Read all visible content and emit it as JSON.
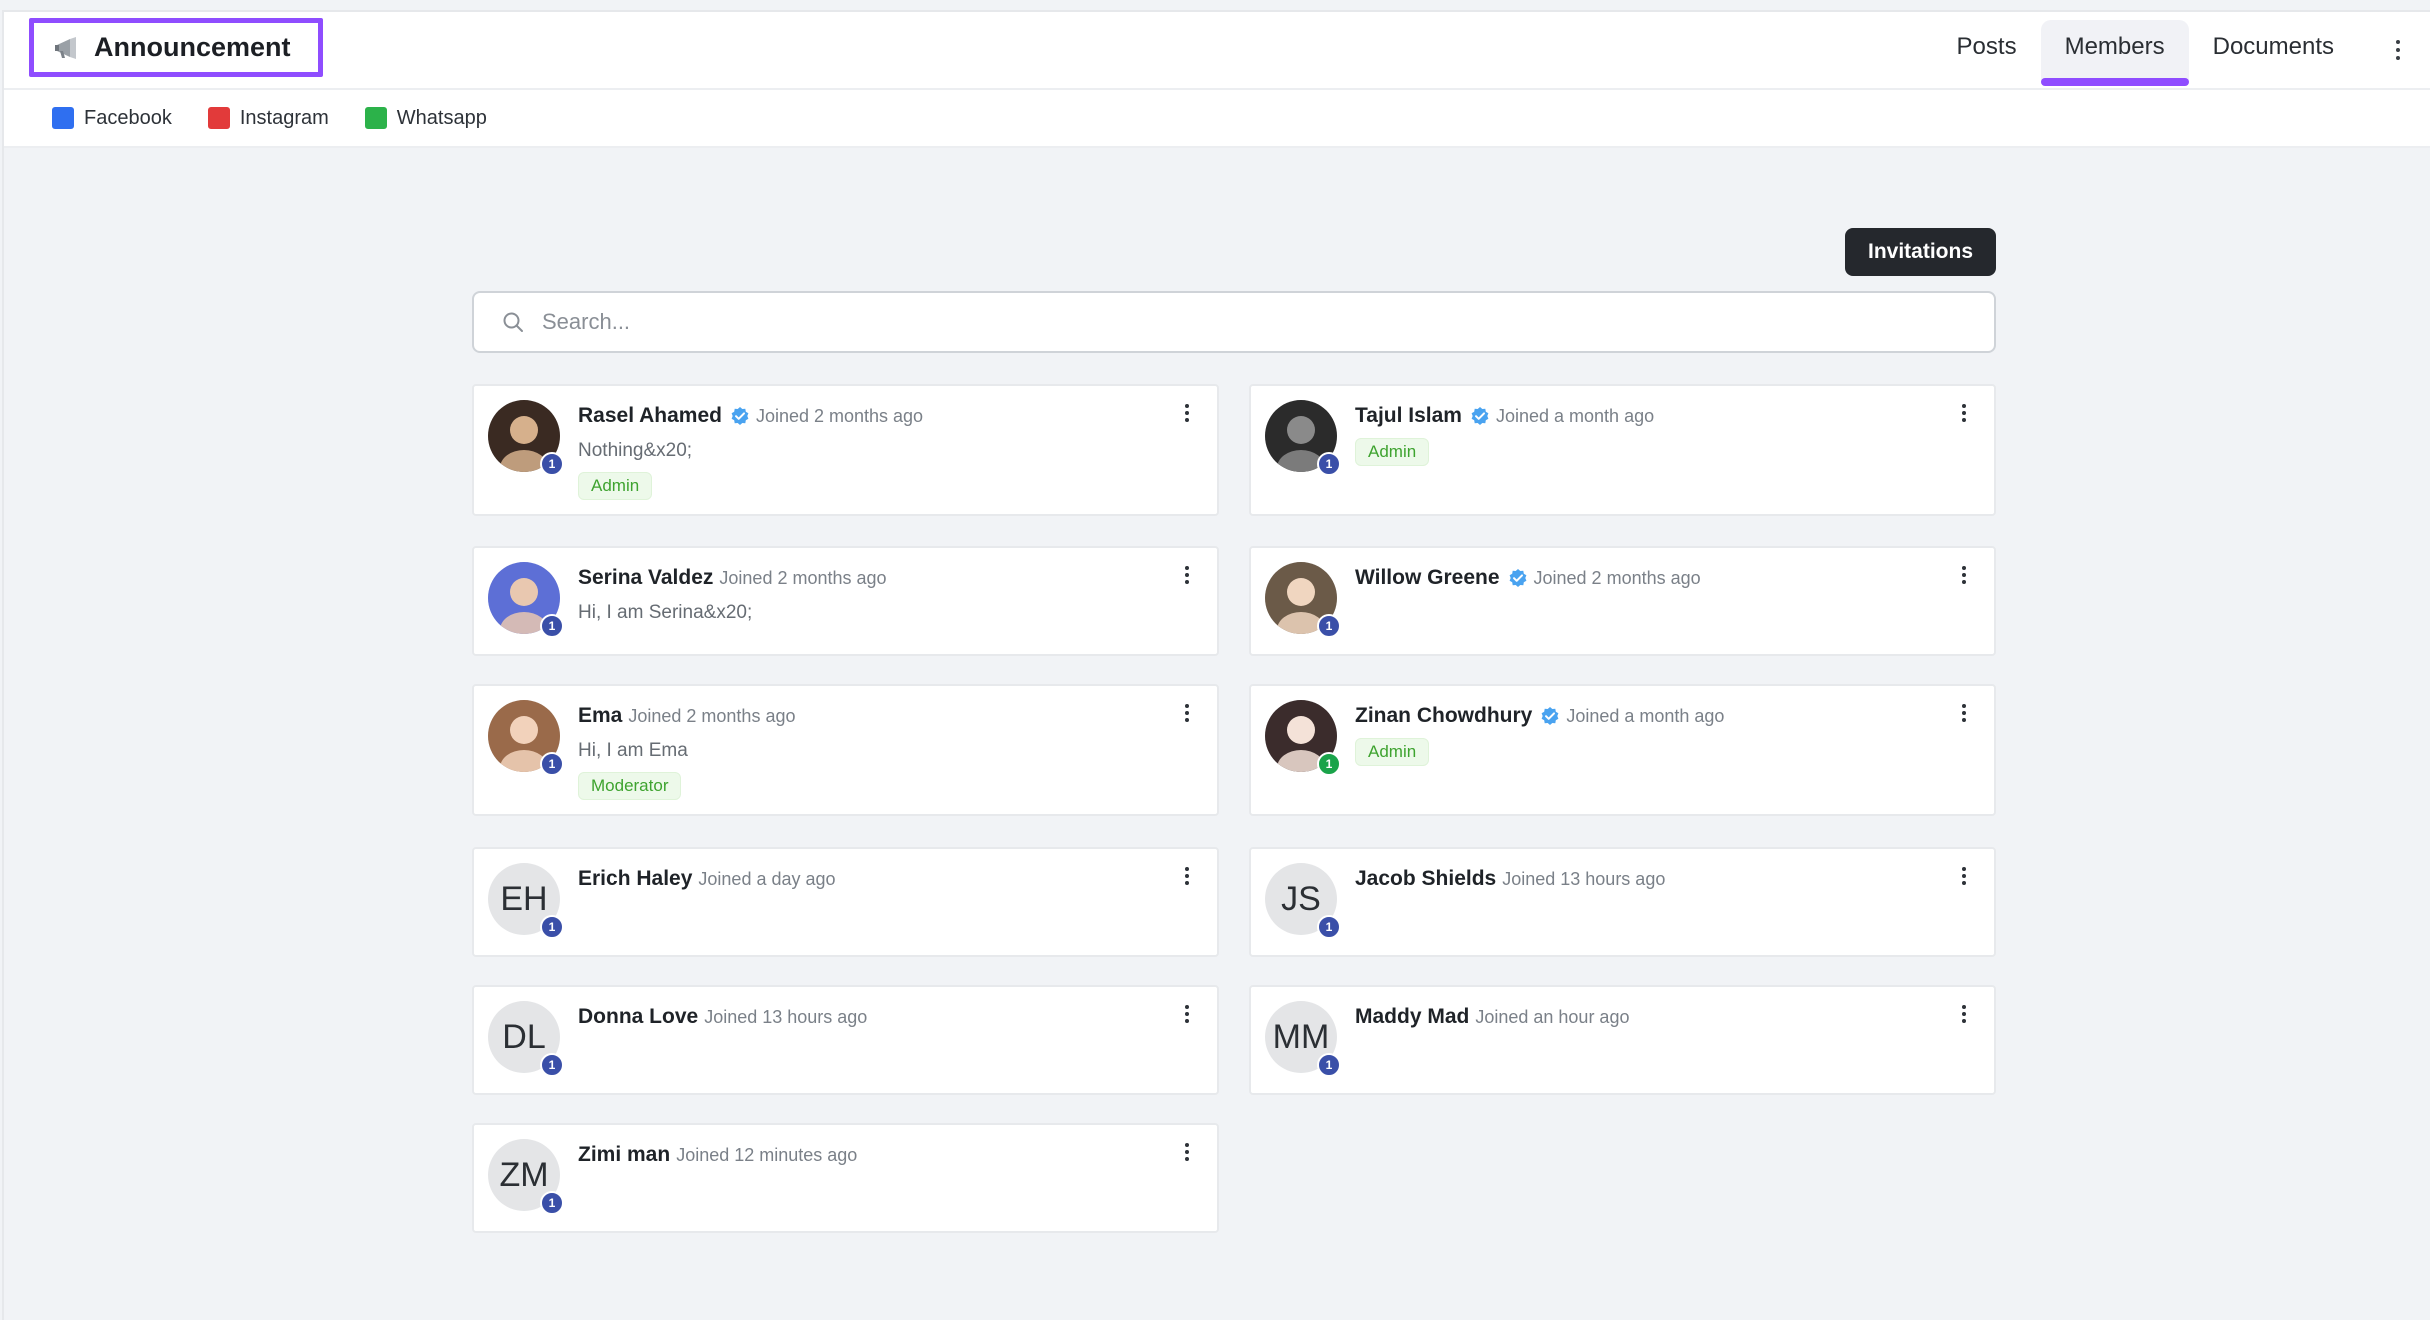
{
  "header": {
    "title": "Announcement",
    "tabs": [
      {
        "label": "Posts",
        "active": false
      },
      {
        "label": "Members",
        "active": true
      },
      {
        "label": "Documents",
        "active": false
      }
    ],
    "accent_color": "#8f4dff"
  },
  "links": [
    {
      "label": "Facebook",
      "color": "#2f6ff0"
    },
    {
      "label": "Instagram",
      "color": "#e23a3a"
    },
    {
      "label": "Whatsapp",
      "color": "#2cb24a"
    }
  ],
  "toolbar": {
    "invitations_label": "Invitations"
  },
  "search": {
    "placeholder": "Search..."
  },
  "members": [
    {
      "name": "Rasel Ahamed",
      "verified": true,
      "joined": "Joined 2 months ago",
      "bio": "Nothing&x20;",
      "role": "Admin",
      "badge": "1",
      "avatar": "photo"
    },
    {
      "name": "Tajul Islam",
      "verified": true,
      "joined": "Joined a month ago",
      "bio": "",
      "role": "Admin",
      "badge": "1",
      "avatar": "photo"
    },
    {
      "name": "Serina Valdez",
      "verified": false,
      "joined": "Joined 2 months ago",
      "bio": "Hi, I am Serina&x20;",
      "role": "",
      "badge": "1",
      "avatar": "photo"
    },
    {
      "name": "Willow Greene",
      "verified": true,
      "joined": "Joined 2 months ago",
      "bio": "",
      "role": "",
      "badge": "1",
      "avatar": "photo"
    },
    {
      "name": "Ema",
      "verified": false,
      "joined": "Joined 2 months ago",
      "bio": "Hi, I am Ema",
      "role": "Moderator",
      "badge": "1",
      "avatar": "photo"
    },
    {
      "name": "Zinan Chowdhury",
      "verified": true,
      "joined": "Joined a month ago",
      "bio": "",
      "role": "Admin",
      "badge": "1",
      "avatar": "photo"
    },
    {
      "name": "Erich Haley",
      "verified": false,
      "joined": "Joined a day ago",
      "bio": "",
      "role": "",
      "badge": "1",
      "avatar": "EH"
    },
    {
      "name": "Jacob Shields",
      "verified": false,
      "joined": "Joined 13 hours ago",
      "bio": "",
      "role": "",
      "badge": "1",
      "avatar": "JS"
    },
    {
      "name": "Donna Love",
      "verified": false,
      "joined": "Joined 13 hours ago",
      "bio": "",
      "role": "",
      "badge": "1",
      "avatar": "DL"
    },
    {
      "name": "Maddy Mad",
      "verified": false,
      "joined": "Joined an hour ago",
      "bio": "",
      "role": "",
      "badge": "1",
      "avatar": "MM"
    },
    {
      "name": "Zimi man",
      "verified": false,
      "joined": "Joined 12 minutes ago",
      "bio": "",
      "role": "",
      "badge": "1",
      "avatar": "ZM"
    }
  ]
}
